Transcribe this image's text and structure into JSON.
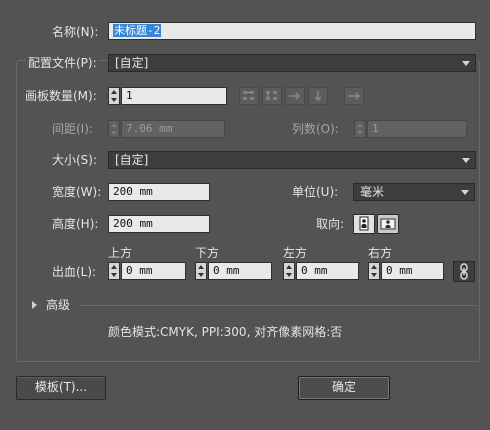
{
  "dialog": {
    "name_label": "名称(N):",
    "name_value": "未标题-2",
    "profile_label": "配置文件(P):",
    "profile_value": "[自定]",
    "artboards_label": "画板数量(M):",
    "artboards_value": "1",
    "spacing_label": "间距(I):",
    "spacing_value": "7.06 mm",
    "columns_label": "列数(O):",
    "columns_value": "1",
    "size_label": "大小(S):",
    "size_value": "[自定]",
    "width_label": "宽度(W):",
    "width_value": "200 mm",
    "units_label": "单位(U):",
    "units_value": "毫米",
    "height_label": "高度(H):",
    "height_value": "200 mm",
    "orientation_label": "取向:",
    "bleed_label": "出血(L):",
    "bleed": [
      {
        "label": "上方",
        "value": "0 mm"
      },
      {
        "label": "下方",
        "value": "0 mm"
      },
      {
        "label": "左方",
        "value": "0 mm"
      },
      {
        "label": "右方",
        "value": "0 mm"
      }
    ],
    "advanced_label": "高级",
    "info_text": "颜色模式:CMYK, PPI:300, 对齐像素网格:否",
    "templates_button": "模板(T)...",
    "ok_button": "确定"
  },
  "icons": {
    "artboard_layout": [
      "grid-by-row-icon",
      "grid-by-column-icon",
      "arrange-by-row-icon",
      "arrange-by-column-icon",
      "right-to-left-icon"
    ],
    "orientation": [
      "portrait-icon",
      "landscape-icon"
    ],
    "link": "chain-link-icon"
  }
}
